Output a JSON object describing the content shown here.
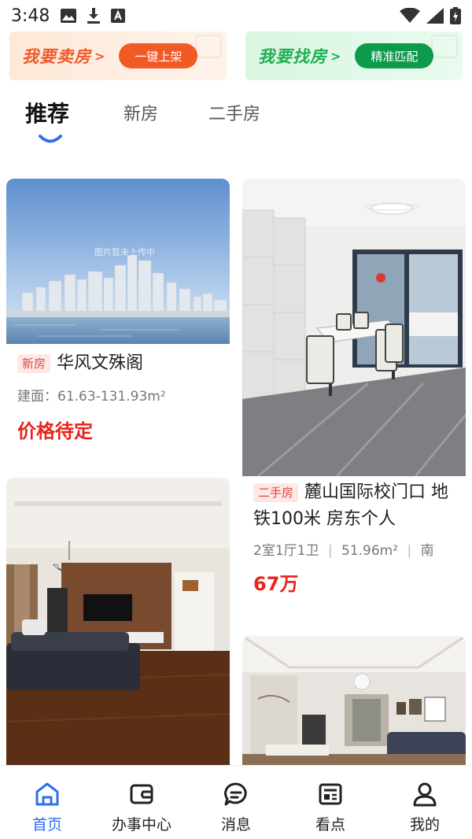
{
  "status_bar": {
    "time": "3:48",
    "left_icons": [
      "image-icon",
      "download-icon",
      "a-box-icon"
    ],
    "right_icons": [
      "wifi-icon",
      "cell-signal-icon",
      "battery-charging-icon"
    ]
  },
  "banners": {
    "sell": {
      "title": "我要卖房",
      "arrow": ">",
      "button": "一键上架",
      "color": "#f25a25"
    },
    "find": {
      "title": "我要找房",
      "arrow": ">",
      "button": "精准匹配",
      "color": "#0e9a4b"
    }
  },
  "tabs": [
    {
      "label": "推荐",
      "active": true
    },
    {
      "label": "新房",
      "active": false
    },
    {
      "label": "二手房",
      "active": false
    }
  ],
  "cards": {
    "card1": {
      "tag": "新房",
      "title": "华风文殊阁",
      "meta": "建面：61.63-131.93m²",
      "price": "价格待定",
      "watermark": "图片暂未上传中"
    },
    "card2": {
      "tag": "二手房",
      "title": "麓山国际校门口 地铁100米 房东个人",
      "meta": [
        "2室1厅1卫",
        "51.96m²",
        "南"
      ],
      "price": "67万"
    }
  },
  "bottom_nav": [
    {
      "label": "首页",
      "icon": "home-icon",
      "active": true
    },
    {
      "label": "办事中心",
      "icon": "wallet-icon",
      "active": false
    },
    {
      "label": "消息",
      "icon": "chat-icon",
      "active": false
    },
    {
      "label": "看点",
      "icon": "news-icon",
      "active": false
    },
    {
      "label": "我的",
      "icon": "user-icon",
      "active": false
    }
  ],
  "colors": {
    "accent": "#2f6ff0",
    "price": "#e8241c",
    "tag_text": "#e04a3a",
    "tag_bg": "#fde8e6"
  }
}
